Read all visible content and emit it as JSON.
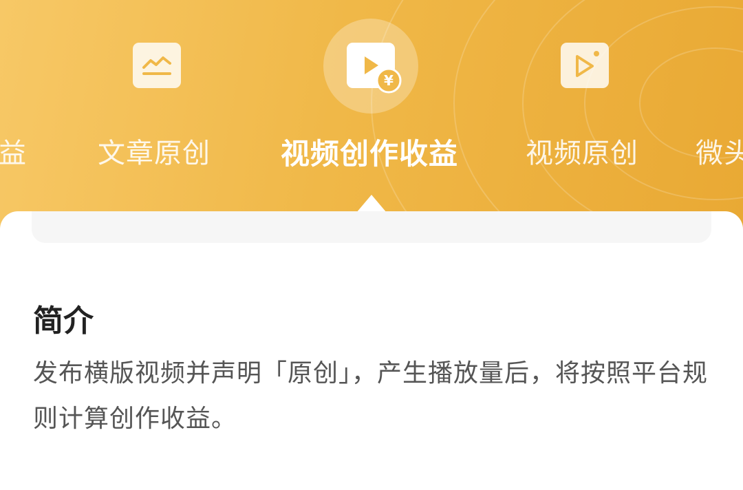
{
  "tabs": [
    {
      "id": "partial-left",
      "label": "益",
      "active": false
    },
    {
      "id": "article-original",
      "label": "文章原创",
      "icon": "chart-card-icon",
      "active": false
    },
    {
      "id": "video-revenue",
      "label": "视频创作收益",
      "icon": "video-yuan-icon",
      "active": true
    },
    {
      "id": "video-original",
      "label": "视频原创",
      "icon": "video-play-icon",
      "active": false
    },
    {
      "id": "partial-right",
      "label": "微头",
      "active": false
    }
  ],
  "detail": {
    "title": "简介",
    "description": "发布横版视频并声明「原创」，产生播放量后，将按照平台规则计算创作收益。"
  },
  "colors": {
    "banner_start": "#f7c866",
    "banner_end": "#e9a934",
    "title_text": "#222222",
    "body_text": "#555555",
    "icon_accent": "#f0b848"
  }
}
